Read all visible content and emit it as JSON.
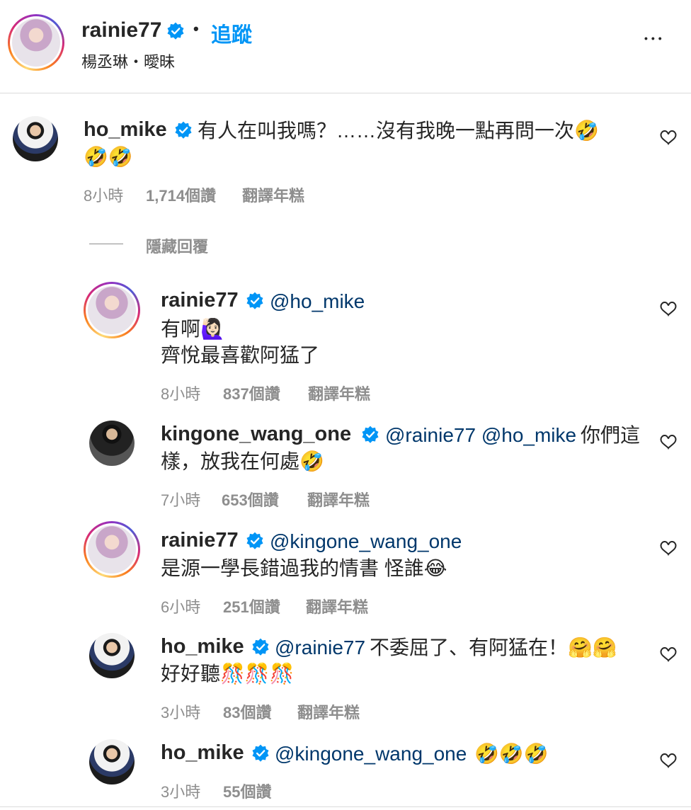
{
  "header": {
    "username": "rainie77",
    "dot": "•",
    "follow_label": "追蹤",
    "subtitle": "楊丞琳・曖昧",
    "more_label": "•••"
  },
  "comment": {
    "username": "ho_mike",
    "text_line1": "有人在叫我嗎？……沒有我晚一點再問一次🤣",
    "text_line2": "🤣🤣",
    "time": "8小時",
    "likes": "1,714個讚",
    "translate": "翻譯年糕",
    "hide_replies": "隱藏回覆"
  },
  "replies": [
    {
      "username": "rainie77",
      "mention": "@ho_mike",
      "text": "",
      "line2": "有啊🙋🏻‍♀️",
      "line3": "齊悅最喜歡阿猛了",
      "time": "8小時",
      "likes": "837個讚",
      "translate": "翻譯年糕"
    },
    {
      "username": "kingone_wang_one",
      "mention": "@rainie77 @ho_mike",
      "text": "你們這",
      "line2": "樣，放我在何處🤣",
      "line3": "",
      "time": "7小時",
      "likes": "653個讚",
      "translate": "翻譯年糕"
    },
    {
      "username": "rainie77",
      "mention": "@kingone_wang_one",
      "text": "",
      "line2": "是源一學長錯過我的情書 怪誰😂",
      "line3": "",
      "time": "6小時",
      "likes": "251個讚",
      "translate": "翻譯年糕"
    },
    {
      "username": "ho_mike",
      "mention": "@rainie77",
      "text": "不委屈了、有阿猛在！🤗🤗",
      "line2": "好好聽🎊🎊🎊",
      "line3": "",
      "time": "3小時",
      "likes": "83個讚",
      "translate": "翻譯年糕"
    },
    {
      "username": "ho_mike",
      "mention": "@kingone_wang_one",
      "text": "🤣🤣🤣",
      "line2": "",
      "line3": "",
      "time": "3小時",
      "likes": "55個讚",
      "translate": ""
    }
  ],
  "colors": {
    "link": "#0095f6",
    "mention": "#00376b",
    "muted": "#8e8e8e",
    "verified": "#0095f6"
  }
}
